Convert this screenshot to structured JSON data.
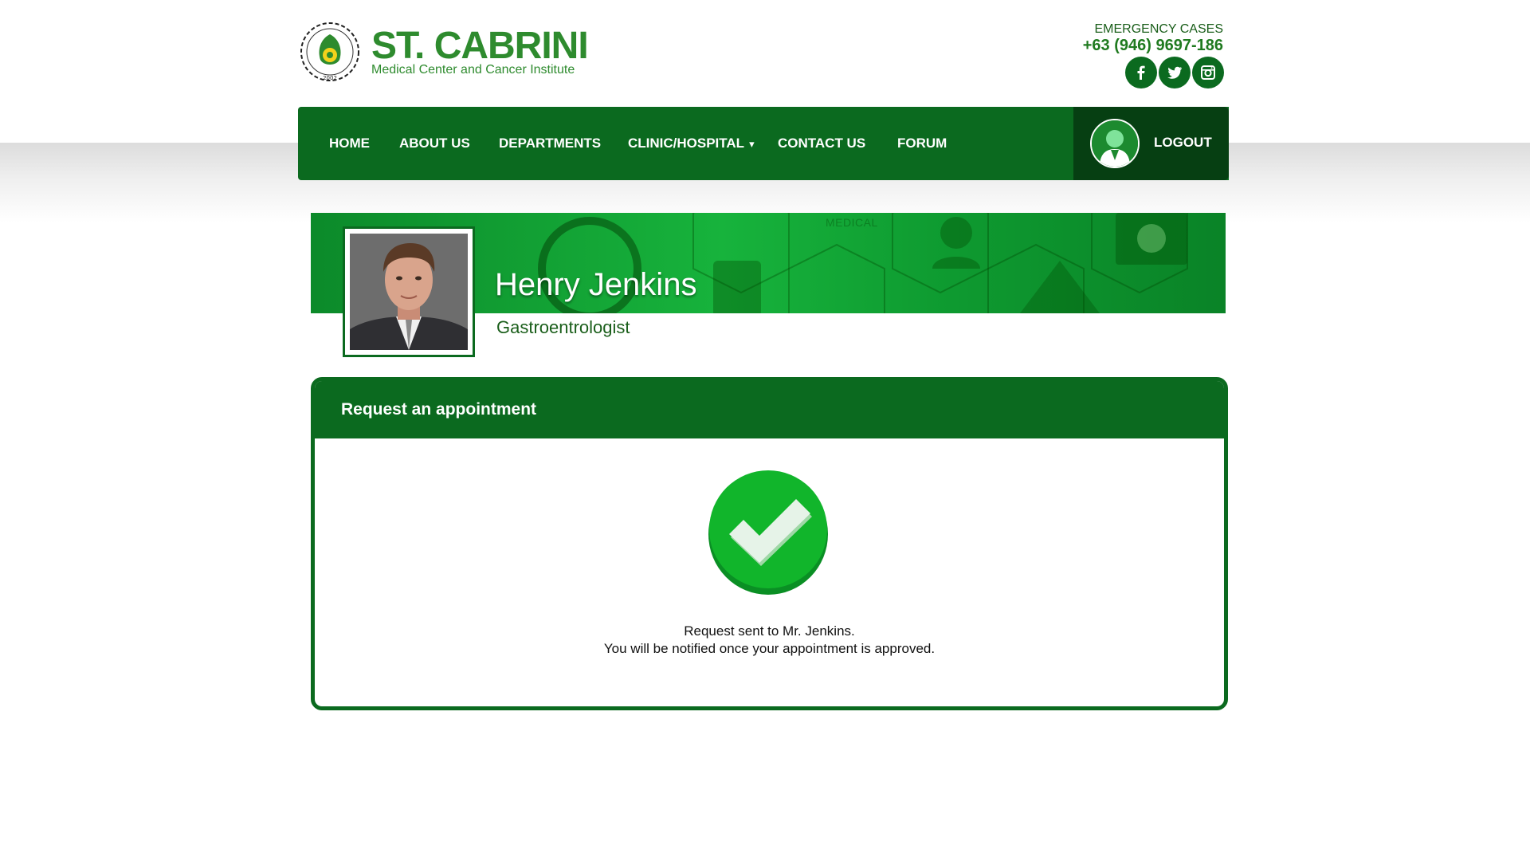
{
  "header": {
    "brand_name": "ST. CABRINI",
    "brand_subtitle": "Medical Center and Cancer Institute",
    "logo_year": "2002",
    "emergency_label": "EMERGENCY CASES",
    "emergency_phone": "+63 (946) 9697-186",
    "social": [
      "facebook-icon",
      "twitter-icon",
      "instagram-icon"
    ]
  },
  "nav": {
    "items": [
      {
        "label": "HOME"
      },
      {
        "label": "ABOUT US"
      },
      {
        "label": "DEPARTMENTS"
      },
      {
        "label": "CLINIC/HOSPITAL",
        "caret": "▾"
      },
      {
        "label": "CONTACT US"
      },
      {
        "label": "FORUM"
      }
    ],
    "logout_label": "LOGOUT"
  },
  "profile": {
    "banner_word": "MEDICAL",
    "name": "Henry Jenkins",
    "specialty": "Gastroentrologist"
  },
  "appointment": {
    "title": "Request an appointment",
    "message_line1": "Request sent to Mr. Jenkins.",
    "message_line2": "You will be notified once your appointment is approved."
  },
  "colors": {
    "primary_green": "#0b6a1f",
    "dark_green": "#063f12",
    "brand_green": "#2e8b2e",
    "success_green": "#11b52b"
  }
}
